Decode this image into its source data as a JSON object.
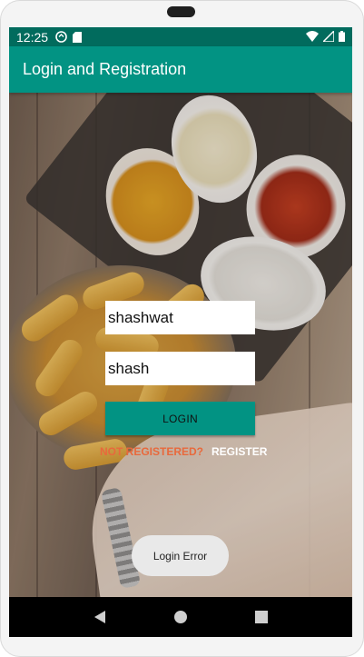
{
  "status_bar": {
    "time": "12:25",
    "icons_left": [
      "sync-icon",
      "sd-card-icon"
    ],
    "icons_right": [
      "wifi-icon",
      "signal-icon",
      "battery-icon"
    ]
  },
  "app_bar": {
    "title": "Login and Registration"
  },
  "form": {
    "username_value": "shashwat",
    "password_value": "shash",
    "login_label": "LOGIN",
    "not_registered_label": "NOT REGISTERED?",
    "register_label": "REGISTER"
  },
  "toast": {
    "message": "Login Error"
  },
  "nav_bar": {
    "buttons": [
      "back-icon",
      "home-icon",
      "recents-icon"
    ]
  },
  "colors": {
    "primary": "#029383",
    "primary_dark": "#016b5d",
    "accent_link": "#e8693c"
  }
}
